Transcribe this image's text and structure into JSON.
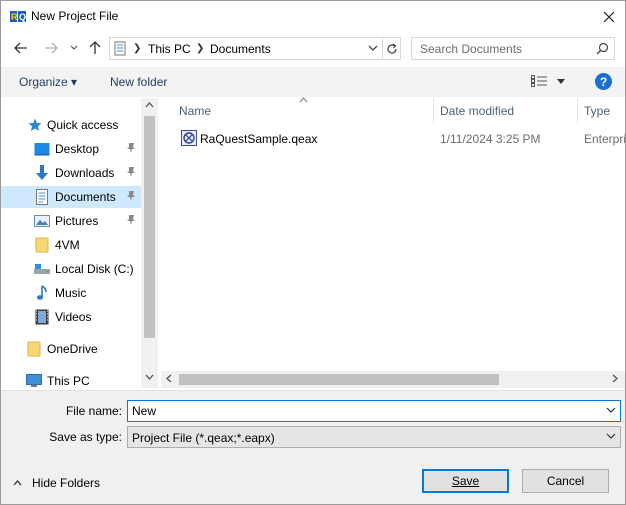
{
  "window": {
    "title": "New Project File"
  },
  "address_bar": {
    "crumbs": [
      "This PC",
      "Documents"
    ]
  },
  "search": {
    "placeholder": "Search Documents"
  },
  "command_bar": {
    "organize_label": "Organize ▾",
    "new_folder_label": "New folder",
    "help_label": "?"
  },
  "nav_pane": {
    "items": [
      {
        "label": "Quick access",
        "icon": "star-icon"
      },
      {
        "label": "Desktop",
        "icon": "desktop-icon",
        "pinned": true
      },
      {
        "label": "Downloads",
        "icon": "download-arrow-icon",
        "pinned": true
      },
      {
        "label": "Documents",
        "icon": "document-icon",
        "pinned": true,
        "selected": true
      },
      {
        "label": "Pictures",
        "icon": "pictures-icon",
        "pinned": true
      },
      {
        "label": "4VM",
        "icon": "folder-icon"
      },
      {
        "label": "Local Disk (C:)",
        "icon": "drive-icon"
      },
      {
        "label": "Music",
        "icon": "music-icon"
      },
      {
        "label": "Videos",
        "icon": "video-icon"
      },
      {
        "label": "OneDrive",
        "icon": "folder-icon"
      },
      {
        "label": "This PC",
        "icon": "monitor-icon"
      }
    ]
  },
  "file_list": {
    "columns": [
      "Name",
      "Date modified",
      "Type"
    ],
    "rows": [
      {
        "name": "RaQuestSample.qeax",
        "date": "1/11/2024 3:25 PM",
        "type": "Enterpris"
      }
    ]
  },
  "bottom": {
    "file_name_label": "File name:",
    "file_name_value": "New",
    "save_type_label": "Save as type:",
    "save_type_value": "Project File (*.qeax;*.eapx)",
    "hide_folders_label": "Hide Folders",
    "save_label": "Save",
    "cancel_label": "Cancel"
  },
  "colors": {
    "accent": "#0078d7",
    "selected_bg": "#cde8ff",
    "help_blue": "#1a6fd0"
  }
}
